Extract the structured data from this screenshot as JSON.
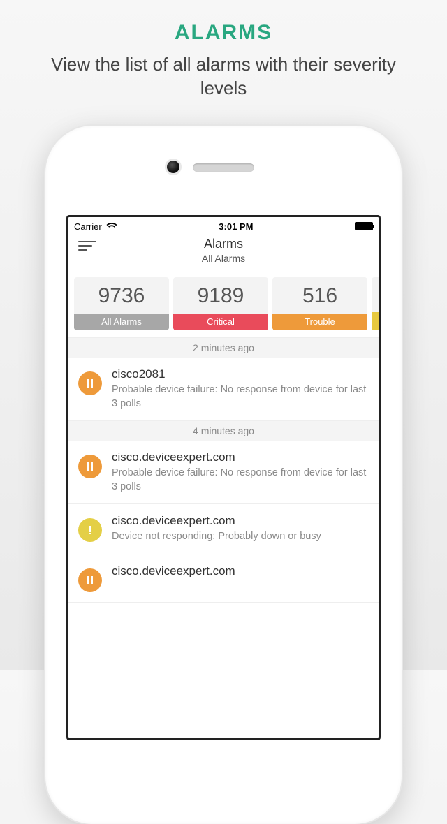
{
  "promo": {
    "title": "ALARMS",
    "subtitle": "View the list of all alarms with their severity levels"
  },
  "statusbar": {
    "carrier": "Carrier",
    "time": "3:01 PM"
  },
  "nav": {
    "title": "Alarms",
    "subtitle": "All Alarms"
  },
  "chips": [
    {
      "count": "9736",
      "label": "All Alarms",
      "cls": "chip-all"
    },
    {
      "count": "9189",
      "label": "Critical",
      "cls": "chip-critical"
    },
    {
      "count": "516",
      "label": "Trouble",
      "cls": "chip-trouble"
    }
  ],
  "sections": [
    {
      "time": "2 minutes ago",
      "items": [
        {
          "dot": "orange",
          "glyph": "pause",
          "title": "cisco2081",
          "desc": "Probable device failure: No response from device for last 3 polls"
        }
      ]
    },
    {
      "time": "4 minutes ago",
      "items": [
        {
          "dot": "orange",
          "glyph": "pause",
          "title": "cisco.deviceexpert.com",
          "desc": "Probable device failure: No response from device for last 3 polls"
        },
        {
          "dot": "yellow",
          "glyph": "bang",
          "title": "cisco.deviceexpert.com",
          "desc": "Device not responding: Probably down or busy"
        },
        {
          "dot": "orange",
          "glyph": "pause",
          "title": "cisco.deviceexpert.com",
          "desc": ""
        }
      ]
    }
  ]
}
